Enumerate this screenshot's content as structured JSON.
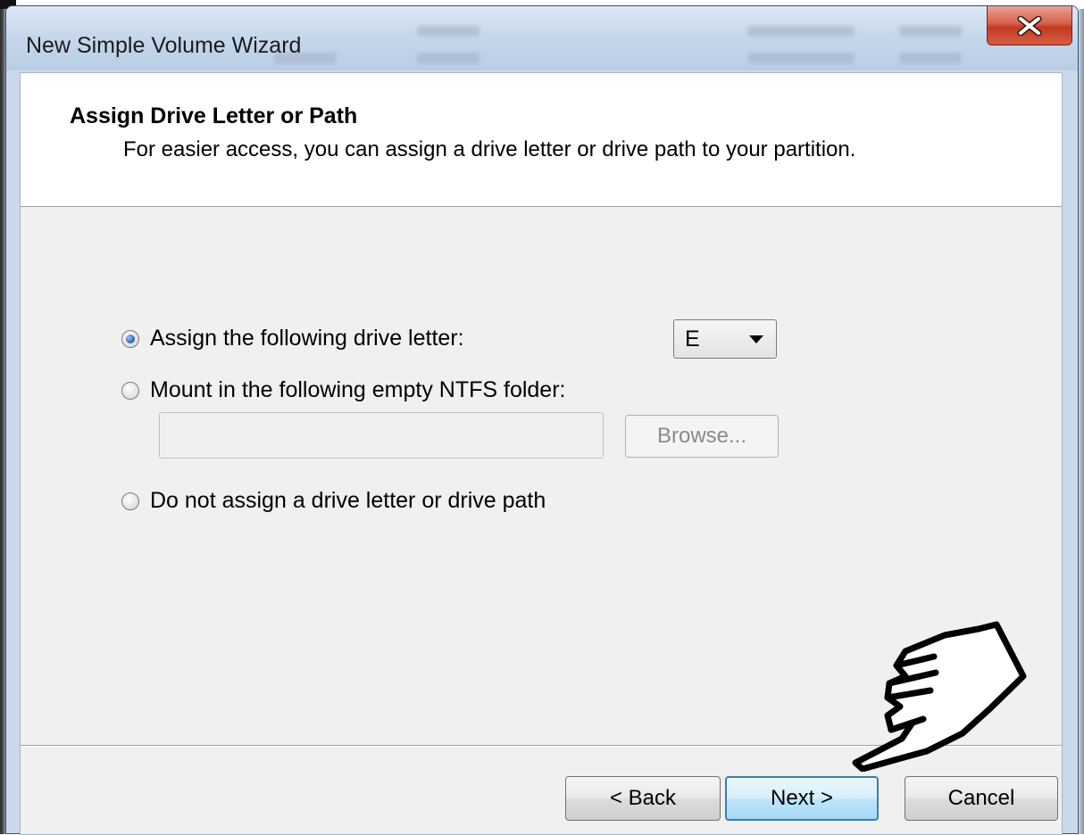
{
  "window": {
    "title": "New Simple Volume Wizard",
    "close_icon": "close-icon"
  },
  "header": {
    "title": "Assign Drive Letter or Path",
    "subtitle": "For easier access, you can assign a drive letter or drive path to your partition."
  },
  "options": [
    {
      "label": "Assign the following drive letter:",
      "checked": true
    },
    {
      "label": "Mount in the following empty NTFS folder:",
      "checked": false
    },
    {
      "label": "Do not assign a drive letter or drive path",
      "checked": false
    }
  ],
  "drive_letter": {
    "selected": "E"
  },
  "folder": {
    "path_value": "",
    "browse_label": "Browse..."
  },
  "footer": {
    "back_label": "< Back",
    "next_label": "Next >",
    "cancel_label": "Cancel"
  },
  "overlay": {
    "icon": "pointing-hand-icon"
  },
  "colors": {
    "titlebar": "#c6d8ec",
    "close_button": "#c23a22",
    "default_button_border": "#3c7fb1",
    "radio_selected": "#2a6fc0"
  }
}
